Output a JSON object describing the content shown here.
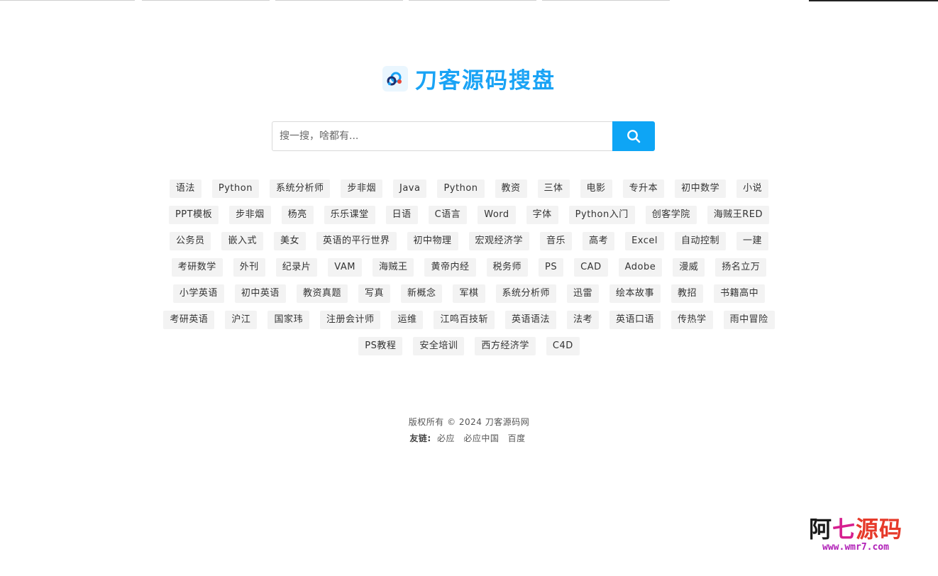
{
  "brand": {
    "title": "刀客源码搜盘",
    "accent": "#1aa3f5",
    "icon": "cloud-link-icon"
  },
  "search": {
    "placeholder": "搜一搜，啥都有...",
    "value": "",
    "button_icon": "search-icon",
    "button_color": "#0ea5f5"
  },
  "tags": [
    "语法",
    "Python",
    "系统分析师",
    "步非烟",
    "Java",
    "Python",
    "教资",
    "三体",
    "电影",
    "专升本",
    "初中数学",
    "小说",
    "PPT模板",
    "步非烟",
    "杨亮",
    "乐乐课堂",
    "日语",
    "C语言",
    "Word",
    "字体",
    "Python入门",
    "创客学院",
    "海贼王RED",
    "公务员",
    "嵌入式",
    "美女",
    "英语的平行世界",
    "初中物理",
    "宏观经济学",
    "音乐",
    "高考",
    "Excel",
    "自动控制",
    "一建",
    "考研数学",
    "外刊",
    "纪录片",
    "VAM",
    "海贼王",
    "黄帝内经",
    "税务师",
    "PS",
    "CAD",
    "Adobe",
    "漫威",
    "扬名立万",
    "小学英语",
    "初中英语",
    "教资真题",
    "写真",
    "新概念",
    "军棋",
    "系统分析师",
    "迅雷",
    "绘本故事",
    "教招",
    "书籍高中",
    "考研英语",
    "沪江",
    "国家玮",
    "注册会计师",
    "运维",
    "江鸣百技斩",
    "英语语法",
    "法考",
    "英语口语",
    "传热学",
    "雨中冒险",
    "PS教程",
    "安全培训",
    "西方经济学",
    "C4D"
  ],
  "footer": {
    "copyright": "版权所有 © 2024 刀客源码网",
    "links_label": "友链:",
    "links": [
      "必应",
      "必应中国",
      "百度"
    ]
  },
  "watermark": {
    "title_chars": [
      "阿",
      "七",
      "源",
      "码"
    ],
    "url": "www.wmr7.com"
  }
}
